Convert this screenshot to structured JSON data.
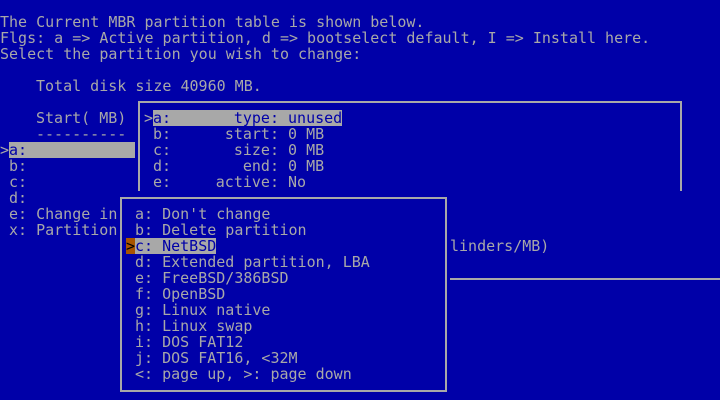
{
  "intro": [
    "The Current MBR partition table is shown below.",
    "Flgs: a => Active partition, d => bootselect default, I => Install here.",
    "Select the partition you wish to change:"
  ],
  "total_disk": "Total disk size 40960 MB.",
  "column_header": "Start( MB)",
  "column_rule": "----------",
  "cursor": ">",
  "partitions": [
    {
      "key": "a:"
    },
    {
      "key": "b:"
    },
    {
      "key": "c:"
    },
    {
      "key": "d:"
    }
  ],
  "main_options": [
    {
      "key": "e:",
      "label": "Change in"
    },
    {
      "key": "x:",
      "label": "Partition"
    }
  ],
  "wrapped_fragment": "linders/MB)",
  "partition_detail": [
    {
      "key": "a:",
      "label": "type:",
      "value": "unused"
    },
    {
      "key": "b:",
      "label": "start:",
      "value": "0 MB"
    },
    {
      "key": "c:",
      "label": "size:",
      "value": "0 MB"
    },
    {
      "key": "d:",
      "label": "end:",
      "value": "0 MB"
    },
    {
      "key": "e:",
      "label": "active:",
      "value": "No"
    }
  ],
  "type_menu": {
    "selected_index": 2,
    "items": [
      {
        "key": "a:",
        "label": "Don't change"
      },
      {
        "key": "b:",
        "label": "Delete partition"
      },
      {
        "key": "c:",
        "label": "NetBSD"
      },
      {
        "key": "d:",
        "label": "Extended partition, LBA"
      },
      {
        "key": "e:",
        "label": "FreeBSD/386BSD"
      },
      {
        "key": "f:",
        "label": "OpenBSD"
      },
      {
        "key": "g:",
        "label": "Linux native"
      },
      {
        "key": "h:",
        "label": "Linux swap"
      },
      {
        "key": "i:",
        "label": "DOS FAT12"
      },
      {
        "key": "j:",
        "label": "DOS FAT16, <32M"
      },
      {
        "key": "<:",
        "label": "page up, >: page down"
      }
    ]
  },
  "colors": {
    "background": "#0000a8",
    "text": "#a8a8a8",
    "highlight": "#a8a8a8",
    "menu_cursor": "#a85400"
  }
}
